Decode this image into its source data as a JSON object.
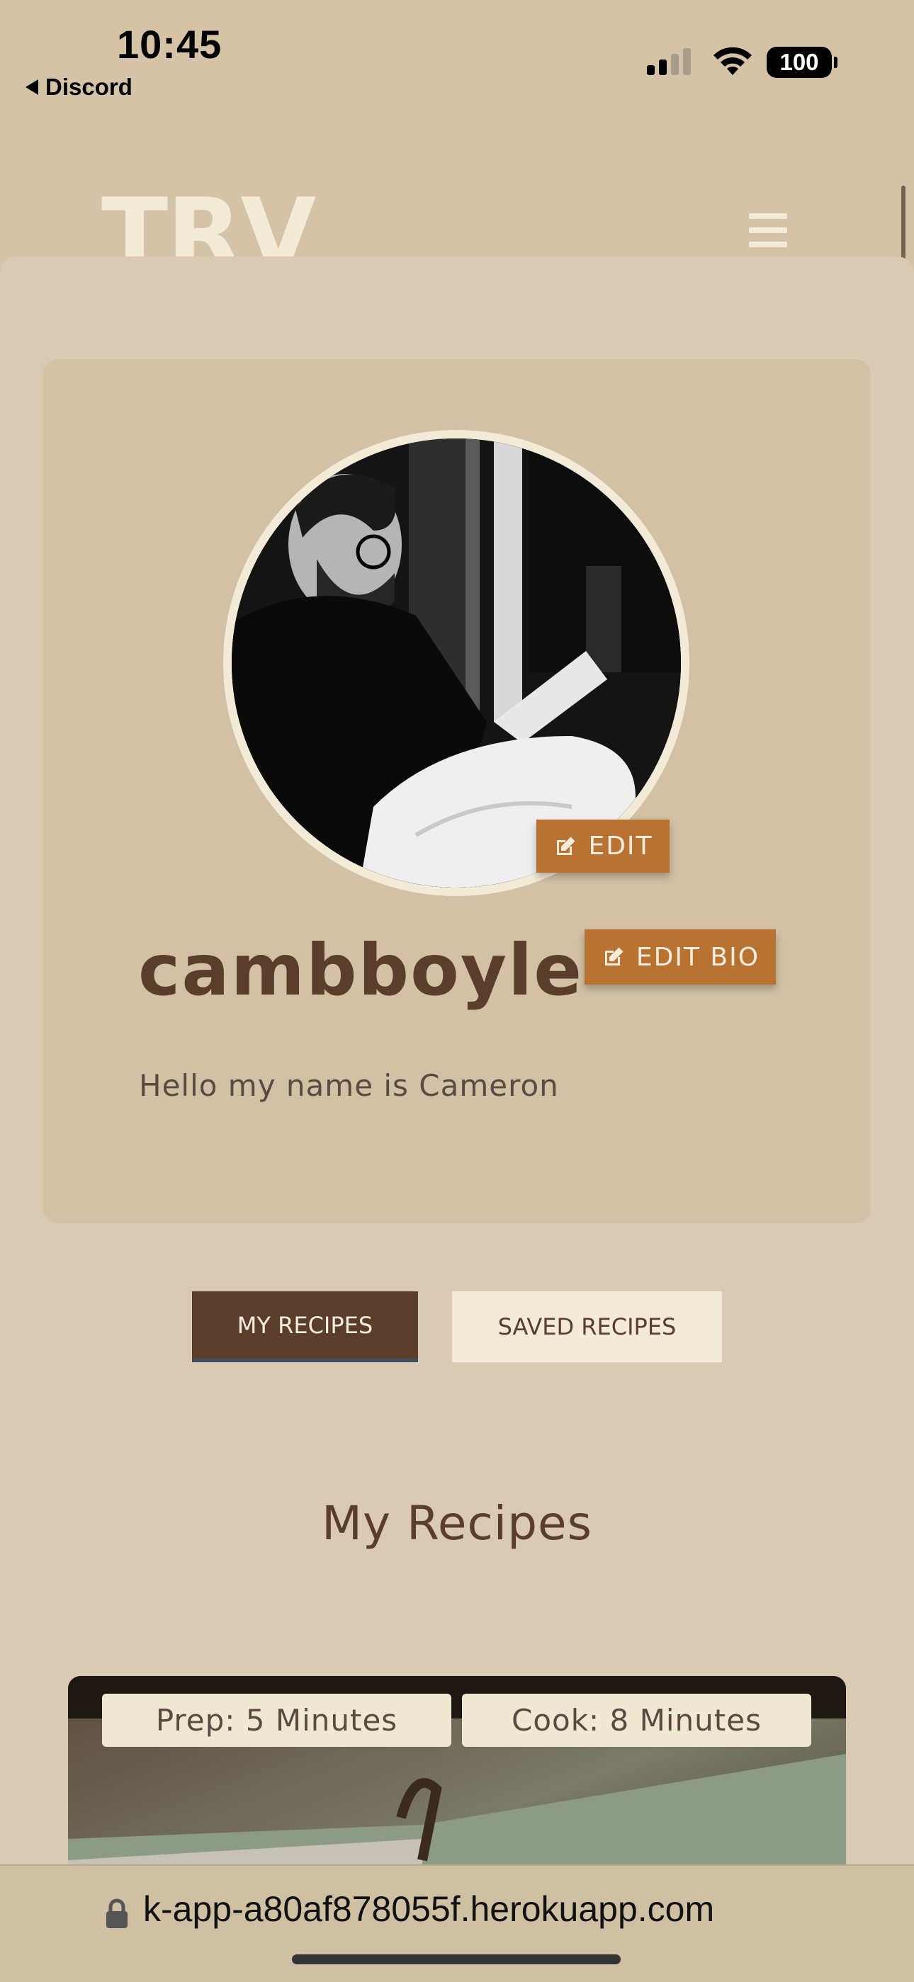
{
  "status_bar": {
    "time": "10:45",
    "back_label": "Discord",
    "battery": "100"
  },
  "header": {
    "logo": "TRV"
  },
  "profile": {
    "edit_photo_label": "EDIT",
    "edit_bio_label": "EDIT BIO",
    "username": "cambboyle",
    "bio": "Hello my name is Cameron"
  },
  "tabs": [
    {
      "label": "MY RECIPES",
      "active": true
    },
    {
      "label": "SAVED RECIPES",
      "active": false
    }
  ],
  "section_title": "My Recipes",
  "recipe": {
    "prep": "Prep: 5 Minutes",
    "cook": "Cook: 8 Minutes"
  },
  "browser": {
    "url": "k-app-a80af878055f.herokuapp.com"
  },
  "colors": {
    "accent_orange": "#b87333",
    "brown": "#5a3d2b",
    "cream": "#f3ead8",
    "background": "#d4c3a7"
  }
}
